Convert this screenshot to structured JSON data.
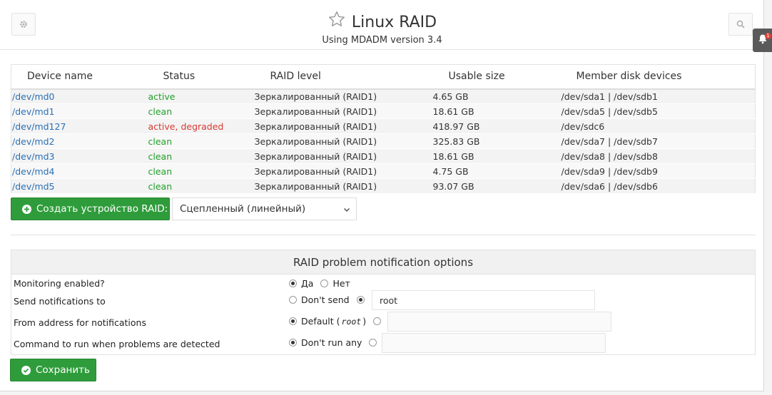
{
  "header": {
    "title": "Linux RAID",
    "subtitle": "Using MDADM version 3.4",
    "left_icon": "gear-icon",
    "right_icon": "search-icon",
    "title_icon": "star-icon",
    "notification_badge": "1"
  },
  "table": {
    "headers": [
      "Device name",
      "Status",
      "RAID level",
      "Usable size",
      "Member disk devices"
    ],
    "rows": [
      {
        "device": "/dev/md0",
        "status": "active",
        "level": "Зеркалированный (RAID1)",
        "size": "4.65 GB",
        "members": "/dev/sda1 | /dev/sdb1"
      },
      {
        "device": "/dev/md1",
        "status": "clean",
        "level": "Зеркалированный (RAID1)",
        "size": "18.61 GB",
        "members": "/dev/sda5 | /dev/sdb5"
      },
      {
        "device": "/dev/md127",
        "status": "active, degraded",
        "level": "Зеркалированный (RAID1)",
        "size": "418.97 GB",
        "members": "/dev/sdc6"
      },
      {
        "device": "/dev/md2",
        "status": "clean",
        "level": "Зеркалированный (RAID1)",
        "size": "325.83 GB",
        "members": "/dev/sda7 | /dev/sdb7"
      },
      {
        "device": "/dev/md3",
        "status": "clean",
        "level": "Зеркалированный (RAID1)",
        "size": "18.61 GB",
        "members": "/dev/sda8 | /dev/sdb8"
      },
      {
        "device": "/dev/md4",
        "status": "clean",
        "level": "Зеркалированный (RAID1)",
        "size": "4.75 GB",
        "members": "/dev/sda9 | /dev/sdb9"
      },
      {
        "device": "/dev/md5",
        "status": "clean",
        "level": "Зеркалированный (RAID1)",
        "size": "93.07 GB",
        "members": "/dev/sda6 | /dev/sdb6"
      }
    ]
  },
  "create": {
    "button_label": "Создать устройство RAID:",
    "select_value": "Сцепленный (линейный)"
  },
  "notify": {
    "title": "RAID problem notification options",
    "monitoring_label": "Monitoring enabled?",
    "monitoring_yes": "Да",
    "monitoring_no": "Нет",
    "send_label": "Send notifications to",
    "send_dont": "Don't send",
    "send_value": "root",
    "from_label": "From address for notifications",
    "from_default_prefix": "Default (",
    "from_default_value": "root",
    "from_default_suffix": ")",
    "from_value": "",
    "cmd_label": "Command to run when problems are detected",
    "cmd_none": "Don't run any",
    "cmd_value": ""
  },
  "save": {
    "label": "Сохранить"
  },
  "colors": {
    "ok": "#21a02a",
    "bad": "#d73a32",
    "link": "#2a6fb3",
    "button": "#2f9c3b"
  }
}
